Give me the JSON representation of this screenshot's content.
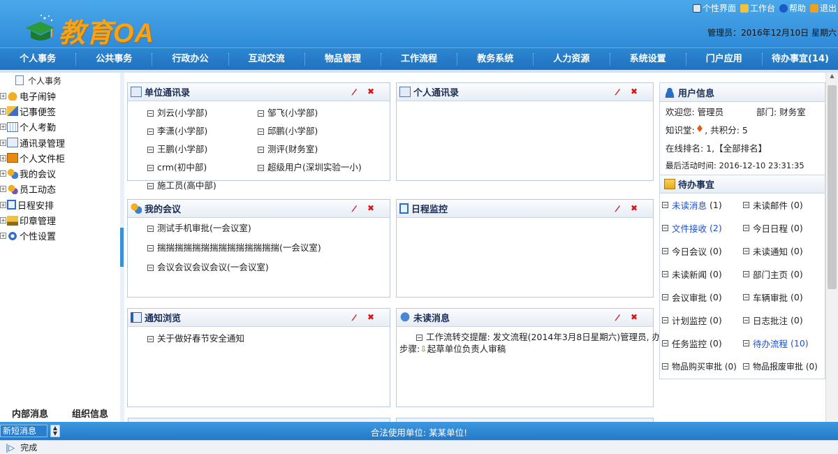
{
  "header": {
    "logo_text": "教育OA",
    "top_links": [
      {
        "label": "个性界面",
        "icon": "monitor-icon"
      },
      {
        "label": "工作台",
        "icon": "folder-icon"
      },
      {
        "label": "帮助",
        "icon": "help-icon"
      },
      {
        "label": "退出",
        "icon": "exit-icon"
      }
    ],
    "admin_info": "管理员：2016年12月10日 星期六"
  },
  "nav": {
    "items": [
      "个人事务",
      "公共事务",
      "行政办公",
      "互动交流",
      "物品管理",
      "工作流程",
      "教务系统",
      "人力资源",
      "系统设置",
      "门户应用",
      "待办事宜(14)"
    ]
  },
  "sidebar": {
    "root_label": "个人事务",
    "items": [
      {
        "label": "电子闹钟",
        "icon": "bell-icon"
      },
      {
        "label": "记事便签",
        "icon": "note-icon"
      },
      {
        "label": "个人考勤",
        "icon": "calendar-icon"
      },
      {
        "label": "通讯录管理",
        "icon": "contacts-icon"
      },
      {
        "label": "个人文件柜",
        "icon": "cabinet-icon"
      },
      {
        "label": "我的会议",
        "icon": "meeting-icon"
      },
      {
        "label": "员工动态",
        "icon": "people-icon"
      },
      {
        "label": "日程安排",
        "icon": "schedule-icon"
      },
      {
        "label": "印章管理",
        "icon": "stamp-icon"
      },
      {
        "label": "个性设置",
        "icon": "settings-icon"
      }
    ],
    "bottom_tabs": [
      "内部消息",
      "组织信息"
    ]
  },
  "portlets": {
    "unit_contacts": {
      "title": "单位通讯录",
      "entries": [
        "刘云(小学部)",
        "邹飞(小学部)",
        "李潇(小学部)",
        "邱鹏(小学部)",
        "王鹏(小学部)",
        "测评(财务室)",
        "crm(初中部)",
        "超级用户(深圳实验一小)",
        "施工员(高中部)"
      ]
    },
    "personal_contacts": {
      "title": "个人通讯录"
    },
    "my_meetings": {
      "title": "我的会议",
      "entries": [
        "测试手机审批(一会议室)",
        "揣揣揣揣揣揣揣揣揣揣揣揣揣揣(一会议室)",
        "会议会议会议会议(一会议室)"
      ]
    },
    "schedule_monitor": {
      "title": "日程监控"
    },
    "notice_browse": {
      "title": "通知浏览",
      "entries": [
        "关于做好春节安全通知"
      ]
    },
    "unread_messages": {
      "title": "未读消息",
      "message_line1": "工作流转交提醒: 发文流程(2014年3月8日星期六)管理员, 办理",
      "message_prefix": "步骤:",
      "message_suffix": "起草单位负责人审稿"
    }
  },
  "user_info": {
    "title": "用户信息",
    "welcome": "欢迎您: 管理员",
    "department": "部门: 财务室",
    "knowledge_prefix": "知识堂:",
    "knowledge_suffix": ", 共积分: 5",
    "ranking_prefix": "在线排名: 1,",
    "ranking_link": "【全部排名】",
    "last_active": "最后活动时间: 2016-12-10 23:31:35"
  },
  "todo": {
    "title": "待办事宜",
    "items": [
      {
        "label": "未读消息",
        "count": "(1)",
        "link": true
      },
      {
        "label": "未读邮件",
        "count": "(0)",
        "link": false
      },
      {
        "label": "文件接收",
        "count": "(2)",
        "link": true
      },
      {
        "label": "今日日程",
        "count": "(0)",
        "link": false
      },
      {
        "label": "今日会议",
        "count": "(0)",
        "link": false
      },
      {
        "label": "未读通知",
        "count": "(0)",
        "link": false
      },
      {
        "label": "未读新闻",
        "count": "(0)",
        "link": false
      },
      {
        "label": "部门主页",
        "count": "(0)",
        "link": false
      },
      {
        "label": "会议审批",
        "count": "(0)",
        "link": false
      },
      {
        "label": "车辆审批",
        "count": "(0)",
        "link": false
      },
      {
        "label": "计划监控",
        "count": "(0)",
        "link": false
      },
      {
        "label": "日志批注",
        "count": "(0)",
        "link": false
      },
      {
        "label": "任务监控",
        "count": "(0)",
        "link": false
      },
      {
        "label": "待办流程",
        "count": "(10)",
        "link": true
      },
      {
        "label": "物品购买审批",
        "count": "(0)",
        "link": false
      },
      {
        "label": "物品报废审批",
        "count": "(0)",
        "link": false
      }
    ]
  },
  "status_bar": {
    "sms_label": "新短消息",
    "unit_text": "合法使用单位: 某某单位!"
  },
  "footer": {
    "done_label": "完成"
  },
  "colors": {
    "header_blue": "#2f8bd8",
    "logo_orange": "#f5a31a",
    "link_blue": "#1c4fcf",
    "close_red": "#dd1111"
  }
}
